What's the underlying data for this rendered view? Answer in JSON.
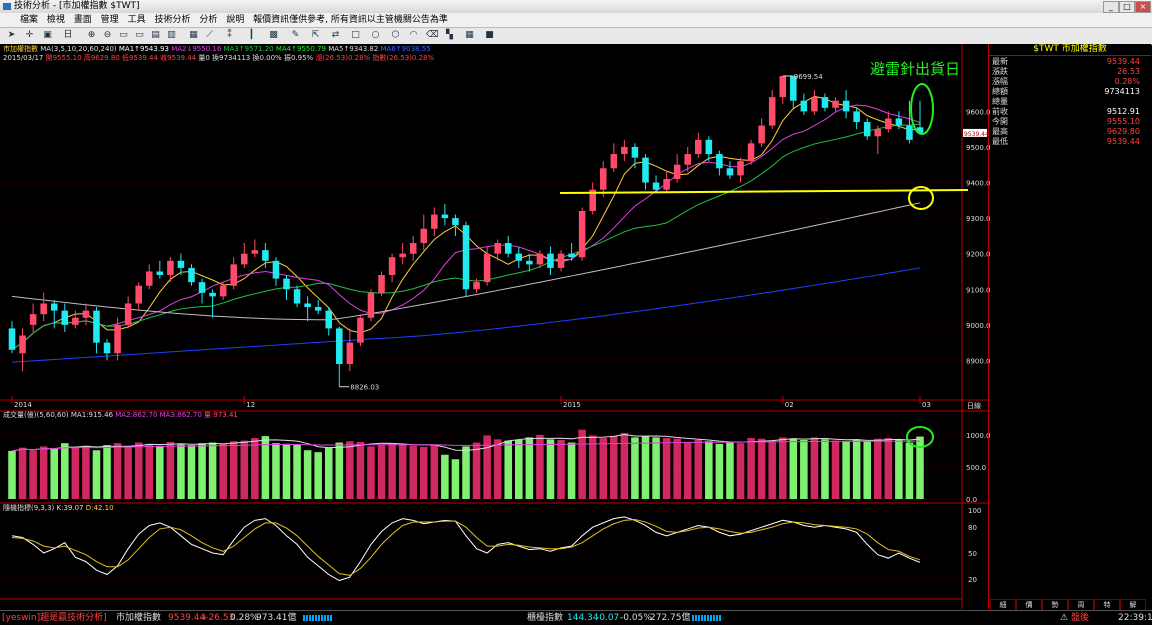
{
  "window": {
    "title": "技術分析 - [市加權指數 $TWT]"
  },
  "menu": [
    "檔案",
    "檢視",
    "畫面",
    "管理",
    "工具",
    "技術分析",
    "分析",
    "說明",
    "報價資訊僅供參考, 所有資訊以主管機關公告為準"
  ],
  "toolbar": {
    "period_label": "日"
  },
  "main_info": {
    "name": "市加權指數",
    "params": "MA(3,5,10,20,60,240)",
    "ma1": "MA1↑9543.93",
    "ma2": "MA2↓9550.16",
    "ma3": "MA3↑9571.20",
    "ma4": "MA4↑9550.79",
    "ma5": "MA5↑9343.82",
    "ma6": "MA6↑9038.55"
  },
  "bar_info": {
    "date": "2015/03/17",
    "open": "開9555.10",
    "high": "高9629.80",
    "low": "低9539.44",
    "close": "收9539.44",
    "volume": "量0",
    "volume2": "換9734113",
    "change_pct": "換0.00%",
    "amplitude": "振0.95%",
    "change": "漲(26.53)0.28%",
    "index_change": "指數(26.53)0.28%"
  },
  "price_labels": {
    "high_mark": "9699.54",
    "low_mark": "8826.03",
    "current_tag": "9539.44",
    "axis": [
      "9600.0",
      "9500.0",
      "9400.0",
      "9300.0",
      "9200.0",
      "9100.0",
      "9000.0",
      "8900.0"
    ]
  },
  "x_labels": {
    "2014": "2014",
    "12": "12",
    "2015": "2015",
    "02": "02",
    "03": "03",
    "axis_unit": "日線"
  },
  "annotation": {
    "text": "避雷針出貨日"
  },
  "volume_panel": {
    "label": "成交量(億)",
    "params": "(5,60,60)",
    "ma1": "MA1:915.46",
    "ma2": "MA2:862.70",
    "ma3": "MA3:862.70",
    "value": "量:973.41",
    "axis": [
      "1000.0",
      "500.0",
      "0.0"
    ]
  },
  "kd_panel": {
    "label": "隨機指標(9,3,3)",
    "k": "K:39.07",
    "d": "D:42.10",
    "axis": [
      "100",
      "80",
      "50",
      "20"
    ]
  },
  "quote_panel": {
    "title": "$TWT 市加權指數",
    "rows": [
      {
        "label": "最新",
        "value": "9539.44",
        "color": "#ff4040"
      },
      {
        "label": "漲跌",
        "value": "26.53",
        "color": "#ff4040"
      },
      {
        "label": "漲幅",
        "value": "0.28%",
        "color": "#ff4040"
      },
      {
        "label": "總額",
        "value": "9734113",
        "color": "#ffffff"
      },
      {
        "label": "總量",
        "value": "",
        "color": "#ffffff"
      },
      {
        "label": "前收",
        "value": "9512.91",
        "color": "#ffffff"
      },
      {
        "label": "今開",
        "value": "9555.10",
        "color": "#ff4040"
      },
      {
        "label": "最高",
        "value": "9629.80",
        "color": "#ff4040"
      },
      {
        "label": "最低",
        "value": "9539.44",
        "color": "#ff4040"
      }
    ]
  },
  "bottom_tabs": [
    "細",
    "價",
    "勢",
    "周",
    "特",
    "解"
  ],
  "status": {
    "brand": "[yeswin]趨是贏技術分析]",
    "index1_name": "市加權指數",
    "index1_value": "9539.44",
    "index1_change": "+26.53",
    "index1_pct": "0.28%",
    "index1_amount": "973.41億",
    "index2_name": "櫃檯指數",
    "index2_value": "144.34",
    "index2_change": "-0.07",
    "index2_pct": "-0.05%",
    "index2_amount": "272.75億",
    "status_text": "盤後",
    "time": "22:39:14"
  },
  "colors": {
    "up": "#ff4a6a",
    "down": "#22e8f0",
    "annotation": "#22ee22",
    "yellow_line": "#ffff00"
  },
  "chart_data": {
    "type": "candlestick",
    "price_ylim": [
      8800,
      9750
    ],
    "candles": [
      [
        8990,
        8930,
        9010,
        8920
      ],
      [
        8920,
        8970,
        8990,
        8870
      ],
      [
        9000,
        9030,
        9060,
        8980
      ],
      [
        9030,
        9060,
        9090,
        9010
      ],
      [
        9060,
        9040,
        9070,
        8990
      ],
      [
        9040,
        9000,
        9060,
        8980
      ],
      [
        9000,
        9020,
        9040,
        8990
      ],
      [
        9020,
        9040,
        9060,
        9000
      ],
      [
        9040,
        8950,
        9050,
        8920
      ],
      [
        8950,
        8920,
        8960,
        8900
      ],
      [
        8920,
        9000,
        9020,
        8900
      ],
      [
        9000,
        9060,
        9080,
        8990
      ],
      [
        9060,
        9110,
        9120,
        9040
      ],
      [
        9110,
        9150,
        9170,
        9100
      ],
      [
        9150,
        9140,
        9180,
        9130
      ],
      [
        9140,
        9180,
        9190,
        9120
      ],
      [
        9180,
        9160,
        9200,
        9140
      ],
      [
        9160,
        9120,
        9170,
        9110
      ],
      [
        9120,
        9090,
        9130,
        9060
      ],
      [
        9090,
        9080,
        9100,
        9020
      ],
      [
        9080,
        9110,
        9120,
        9070
      ],
      [
        9110,
        9170,
        9190,
        9100
      ],
      [
        9170,
        9200,
        9230,
        9160
      ],
      [
        9200,
        9210,
        9240,
        9190
      ],
      [
        9210,
        9180,
        9230,
        9160
      ],
      [
        9180,
        9130,
        9190,
        9110
      ],
      [
        9130,
        9100,
        9140,
        9070
      ],
      [
        9100,
        9060,
        9110,
        9050
      ],
      [
        9060,
        9050,
        9080,
        9010
      ],
      [
        9050,
        9040,
        9070,
        9030
      ],
      [
        9040,
        8990,
        9050,
        8970
      ],
      [
        8990,
        8890,
        8995,
        8826
      ],
      [
        8890,
        8950,
        8990,
        8870
      ],
      [
        8950,
        9020,
        9030,
        8940
      ],
      [
        9020,
        9090,
        9100,
        9010
      ],
      [
        9090,
        9140,
        9150,
        9080
      ],
      [
        9140,
        9190,
        9200,
        9120
      ],
      [
        9190,
        9200,
        9230,
        9170
      ],
      [
        9200,
        9230,
        9250,
        9180
      ],
      [
        9230,
        9270,
        9310,
        9210
      ],
      [
        9270,
        9310,
        9330,
        9250
      ],
      [
        9310,
        9300,
        9340,
        9280
      ],
      [
        9300,
        9280,
        9310,
        9250
      ],
      [
        9280,
        9100,
        9290,
        9080
      ],
      [
        9100,
        9120,
        9130,
        9090
      ],
      [
        9120,
        9200,
        9220,
        9110
      ],
      [
        9200,
        9230,
        9240,
        9180
      ],
      [
        9230,
        9200,
        9250,
        9190
      ],
      [
        9200,
        9180,
        9220,
        9160
      ],
      [
        9180,
        9170,
        9200,
        9150
      ],
      [
        9170,
        9200,
        9210,
        9160
      ],
      [
        9200,
        9160,
        9220,
        9140
      ],
      [
        9160,
        9200,
        9210,
        9150
      ],
      [
        9200,
        9190,
        9230,
        9180
      ],
      [
        9190,
        9320,
        9330,
        9180
      ],
      [
        9320,
        9380,
        9400,
        9310
      ],
      [
        9380,
        9440,
        9460,
        9360
      ],
      [
        9440,
        9480,
        9510,
        9430
      ],
      [
        9480,
        9500,
        9520,
        9460
      ],
      [
        9500,
        9470,
        9510,
        9440
      ],
      [
        9470,
        9400,
        9480,
        9380
      ],
      [
        9400,
        9380,
        9420,
        9370
      ],
      [
        9380,
        9410,
        9430,
        9370
      ],
      [
        9410,
        9450,
        9480,
        9400
      ],
      [
        9450,
        9480,
        9500,
        9430
      ],
      [
        9480,
        9520,
        9540,
        9470
      ],
      [
        9520,
        9480,
        9530,
        9460
      ],
      [
        9480,
        9440,
        9490,
        9420
      ],
      [
        9440,
        9420,
        9460,
        9410
      ],
      [
        9420,
        9460,
        9470,
        9400
      ],
      [
        9460,
        9510,
        9520,
        9450
      ],
      [
        9510,
        9560,
        9580,
        9500
      ],
      [
        9560,
        9640,
        9660,
        9550
      ],
      [
        9640,
        9699.54,
        9699.54,
        9620
      ],
      [
        9699.54,
        9630,
        9700,
        9610
      ],
      [
        9630,
        9600,
        9650,
        9590
      ],
      [
        9600,
        9640,
        9660,
        9590
      ],
      [
        9640,
        9610,
        9650,
        9600
      ],
      [
        9610,
        9630,
        9640,
        9600
      ],
      [
        9630,
        9600,
        9660,
        9580
      ],
      [
        9600,
        9570,
        9610,
        9550
      ],
      [
        9570,
        9530,
        9580,
        9520
      ],
      [
        9530,
        9550,
        9560,
        9480
      ],
      [
        9550,
        9580,
        9600,
        9540
      ],
      [
        9580,
        9560,
        9600,
        9550
      ],
      [
        9560,
        9520,
        9630,
        9510
      ],
      [
        9555.1,
        9539.44,
        9629.8,
        9539.44
      ]
    ],
    "volume_ylim": [
      0,
      1200
    ],
    "volume": [
      750,
      800,
      760,
      820,
      790,
      870,
      800,
      830,
      760,
      840,
      870,
      810,
      880,
      860,
      830,
      890,
      850,
      840,
      870,
      880,
      860,
      900,
      910,
      950,
      980,
      870,
      860,
      850,
      760,
      730,
      800,
      880,
      900,
      890,
      820,
      850,
      870,
      860,
      830,
      810,
      850,
      690,
      620,
      820,
      880,
      990,
      930,
      910,
      920,
      960,
      1000,
      930,
      920,
      880,
      1080,
      990,
      950,
      980,
      1030,
      960,
      980,
      960,
      950,
      940,
      890,
      920,
      900,
      860,
      880,
      870,
      950,
      940,
      910,
      960,
      940,
      920,
      960,
      930,
      910,
      900,
      930,
      900,
      940,
      950,
      930,
      880,
      973.41
    ],
    "kd_ylim": [
      0,
      100
    ],
    "k": [
      70,
      68,
      60,
      50,
      55,
      62,
      45,
      40,
      30,
      25,
      35,
      55,
      72,
      82,
      85,
      80,
      70,
      60,
      55,
      50,
      48,
      65,
      80,
      88,
      90,
      82,
      70,
      60,
      45,
      35,
      25,
      18,
      22,
      40,
      60,
      75,
      85,
      90,
      88,
      84,
      86,
      88,
      87,
      70,
      55,
      50,
      60,
      62,
      58,
      54,
      55,
      52,
      56,
      58,
      70,
      80,
      85,
      90,
      92,
      88,
      82,
      74,
      70,
      74,
      78,
      82,
      80,
      74,
      70,
      72,
      76,
      80,
      84,
      88,
      86,
      82,
      80,
      82,
      80,
      78,
      74,
      60,
      48,
      44,
      50,
      44,
      39.07
    ],
    "d": [
      68,
      67,
      64,
      58,
      56,
      58,
      53,
      48,
      40,
      34,
      34,
      42,
      55,
      68,
      78,
      80,
      77,
      70,
      62,
      56,
      52,
      58,
      68,
      78,
      85,
      85,
      79,
      70,
      58,
      46,
      36,
      26,
      24,
      32,
      45,
      60,
      72,
      82,
      86,
      86,
      86,
      87,
      87,
      80,
      68,
      58,
      58,
      60,
      59,
      57,
      56,
      55,
      55,
      57,
      62,
      70,
      78,
      84,
      88,
      89,
      86,
      81,
      75,
      74,
      76,
      79,
      80,
      78,
      75,
      73,
      74,
      77,
      80,
      84,
      86,
      85,
      83,
      82,
      81,
      80,
      78,
      72,
      62,
      54,
      52,
      46,
      42.1
    ],
    "ma_lines": [
      {
        "name": "MA5",
        "color": "#ffd040"
      },
      {
        "name": "MA10",
        "color": "#e040e0"
      },
      {
        "name": "MA20",
        "color": "#20c040"
      },
      {
        "name": "MA60",
        "color": "#c0c0c0"
      },
      {
        "name": "MA240",
        "color": "#2040ff"
      }
    ]
  }
}
